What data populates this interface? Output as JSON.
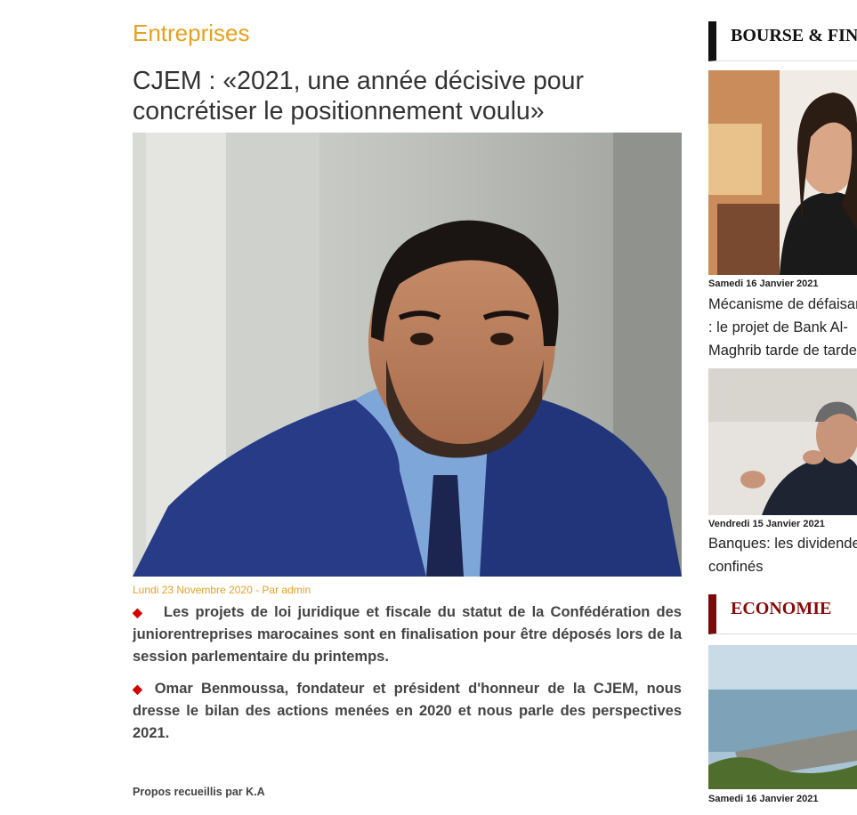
{
  "article": {
    "category": "Entreprises",
    "title": "CJEM : «2021, une année décisive pour concrétiser le positionnement voulu»",
    "meta": "Lundi 23 Novembre 2020 - Par admin",
    "lead1": "Les projets de loi juridique et fiscale du statut de la Confédération des juniorentreprises marocaines sont en finalisation pour être déposés lors de la session parlementaire du printemps.",
    "lead2": "Omar Benmoussa, fondateur et président d'honneur de la CJEM, nous dresse le bilan des actions menées en 2020 et nous parle des perspectives 2021.",
    "credit": "Propos recueillis par K.A"
  },
  "sidebar": {
    "section1": "BOURSE & FINANCE",
    "items": [
      {
        "date": "Samedi 16 Janvier 2021",
        "title": "Mécanisme de défaisance : le projet de Bank Al-Maghrib tarde de tarder"
      },
      {
        "date": "Vendredi 15 Janvier 2021",
        "title": "Banques: les dividendes confinés"
      }
    ],
    "section2": "ECONOMIE",
    "items2": [
      {
        "date": "Samedi 16 Janvier 2021"
      }
    ]
  },
  "colors": {
    "accent": "#e8a020",
    "bullet": "#d40000",
    "economie": "#8b0a0a"
  },
  "icons": {
    "bullet": "red-diamond-icon"
  }
}
